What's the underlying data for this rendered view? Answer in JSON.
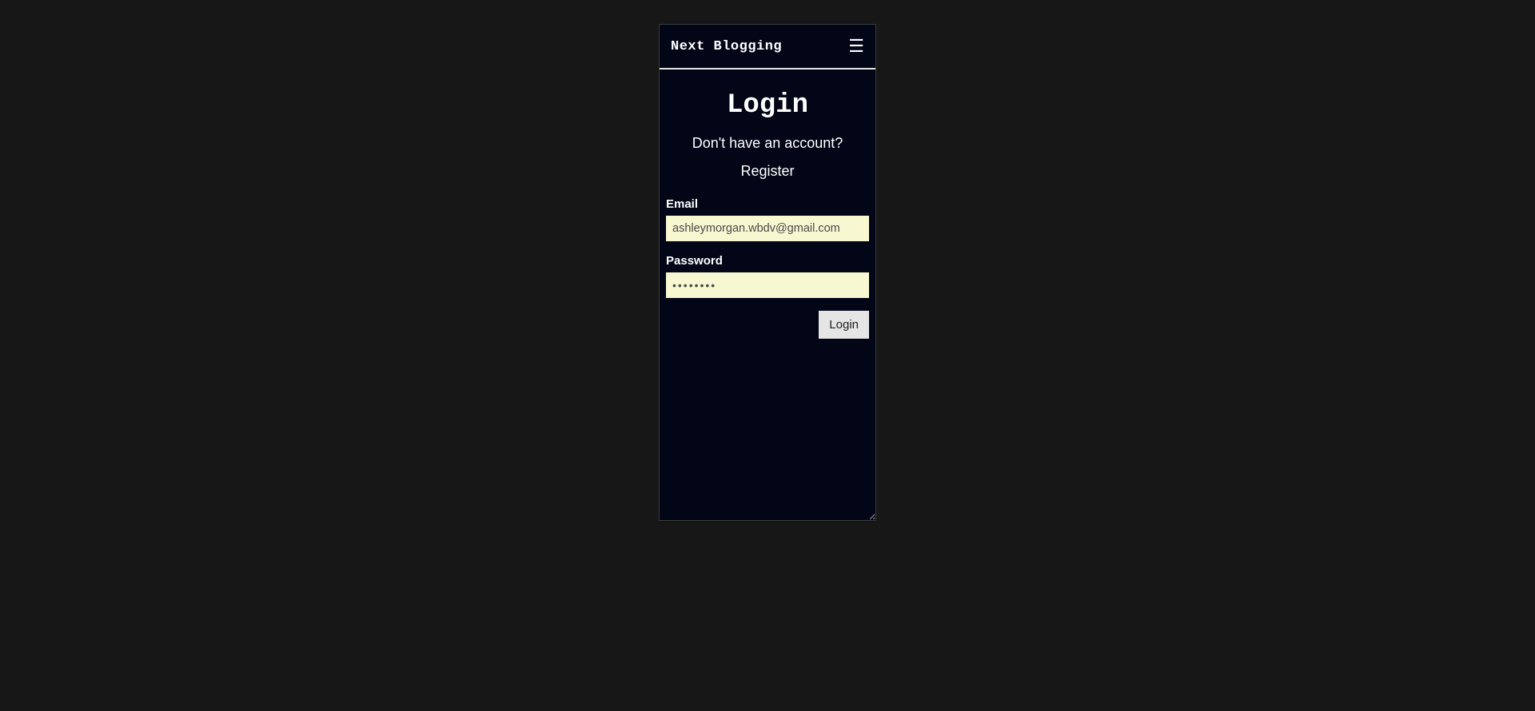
{
  "header": {
    "brand": "Next Blogging",
    "menu_icon": "☰"
  },
  "page": {
    "title": "Login",
    "subtitle": "Don't have an account?",
    "register_link": "Register"
  },
  "form": {
    "email": {
      "label": "Email",
      "value": "ashleymorgan.wbdv@gmail.com"
    },
    "password": {
      "label": "Password",
      "value": "••••••••"
    },
    "submit_label": "Login"
  },
  "colors": {
    "page_bg": "#171717",
    "device_bg": "#020617",
    "autofill_bg": "#f7f7d1",
    "button_bg": "#e5e5e5",
    "text": "#ffffff"
  }
}
